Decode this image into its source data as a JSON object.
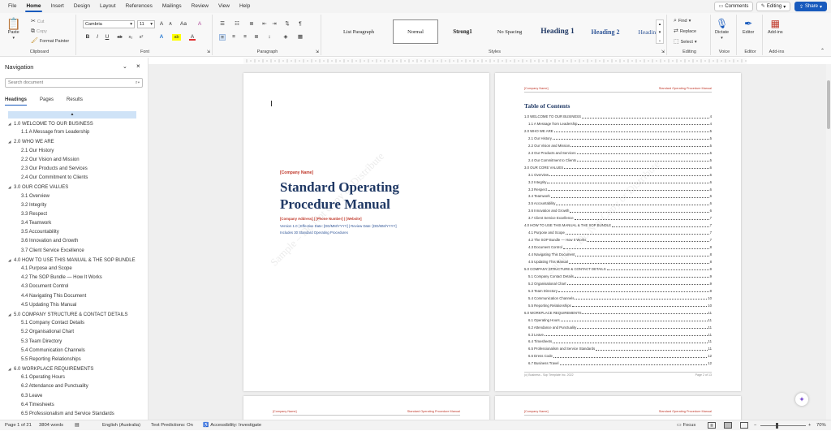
{
  "menu": {
    "tabs": [
      "File",
      "Home",
      "Insert",
      "Design",
      "Layout",
      "References",
      "Mailings",
      "Review",
      "View",
      "Help"
    ],
    "active": "Home"
  },
  "top_right": {
    "comments": "Comments",
    "editing": "Editing",
    "share": "Share"
  },
  "ribbon": {
    "clipboard": {
      "paste": "Paste",
      "cut": "Cut",
      "copy": "Copy",
      "format_painter": "Format Painter",
      "label": "Clipboard"
    },
    "font": {
      "name": "Cambria",
      "size": "11",
      "label": "Font",
      "size_up": "A",
      "size_down": "A",
      "case": "Aa",
      "clear": "A",
      "bold": "B",
      "italic": "I",
      "underline": "U",
      "strike": "ab",
      "subscript": "x₂",
      "superscript": "x²",
      "effects": "A",
      "highlight": "ab",
      "color": "A"
    },
    "paragraph": {
      "label": "Paragraph",
      "pilcrow": "¶"
    },
    "styles": {
      "label": "Styles",
      "items": [
        "List Paragraph",
        "Normal",
        "Strong1",
        "No Spacing",
        "Heading 1",
        "Heading 2",
        "Heading 3"
      ],
      "selected": "Normal"
    },
    "editing": {
      "label": "Editing",
      "find": "Find",
      "replace": "Replace",
      "select": "Select"
    },
    "voice": {
      "label": "Voice",
      "dictate": "Dictate"
    },
    "editor": {
      "label": "Editor",
      "editor": "Editor"
    },
    "addins": {
      "label": "Add-ins",
      "addins": "Add-ins"
    }
  },
  "nav": {
    "title": "Navigation",
    "search_placeholder": "Search document",
    "tabs": [
      "Headings",
      "Pages",
      "Results"
    ],
    "active_tab": "Headings",
    "collapse": "▲",
    "items": [
      {
        "level": 1,
        "text": "1.0  WELCOME TO OUR BUSINESS"
      },
      {
        "level": 2,
        "text": "1.1  A Message from Leadership"
      },
      {
        "level": 1,
        "text": "2.0  WHO WE ARE"
      },
      {
        "level": 2,
        "text": "2.1  Our History"
      },
      {
        "level": 2,
        "text": "2.2  Our Vision and Mission"
      },
      {
        "level": 2,
        "text": "2.3  Our Products and Services"
      },
      {
        "level": 2,
        "text": "2.4  Our Commitment to Clients"
      },
      {
        "level": 1,
        "text": "3.0  OUR CORE VALUES"
      },
      {
        "level": 2,
        "text": "3.1  Overview"
      },
      {
        "level": 2,
        "text": "3.2  Integrity"
      },
      {
        "level": 2,
        "text": "3.3  Respect"
      },
      {
        "level": 2,
        "text": "3.4  Teamwork"
      },
      {
        "level": 2,
        "text": "3.5  Accountability"
      },
      {
        "level": 2,
        "text": "3.6  Innovation and Growth"
      },
      {
        "level": 2,
        "text": "3.7  Client Service Excellence"
      },
      {
        "level": 1,
        "text": "4.0  HOW TO USE THIS MANUAL & THE SOP BUNDLE"
      },
      {
        "level": 2,
        "text": "4.1  Purpose and Scope"
      },
      {
        "level": 2,
        "text": "4.2  The SOP Bundle — How It Works"
      },
      {
        "level": 2,
        "text": "4.3  Document Control"
      },
      {
        "level": 2,
        "text": "4.4  Navigating This Document"
      },
      {
        "level": 2,
        "text": "4.5  Updating This Manual"
      },
      {
        "level": 1,
        "text": "5.0  COMPANY STRUCTURE & CONTACT DETAILS"
      },
      {
        "level": 2,
        "text": "5.1  Company Contact Details"
      },
      {
        "level": 2,
        "text": "5.2  Organisational Chart"
      },
      {
        "level": 2,
        "text": "5.3  Team Directory"
      },
      {
        "level": 2,
        "text": "5.4  Communication Channels"
      },
      {
        "level": 2,
        "text": "5.5  Reporting Relationships"
      },
      {
        "level": 1,
        "text": "6.0  WORKPLACE REQUIREMENTS"
      },
      {
        "level": 2,
        "text": "6.1  Operating Hours"
      },
      {
        "level": 2,
        "text": "6.2  Attendance and Punctuality"
      },
      {
        "level": 2,
        "text": "6.3  Leave"
      },
      {
        "level": 2,
        "text": "6.4  Timesheets"
      },
      {
        "level": 2,
        "text": "6.5  Professionalism and Service Standards"
      }
    ]
  },
  "cover": {
    "company": "[Company Name]",
    "title_line1": "Standard Operating",
    "title_line2": "Procedure Manual",
    "address": "[Company Address]   |   [Phone Number]   |   [Website]",
    "version": "Version 1.0   |   Effective Date: [DD/MM/YYYY]   |   Review Date: [DD/MM/YYYY]",
    "includes": "Includes 30 Standard Operating Procedures",
    "watermark": "Sample – Do Not Copy or Distribute"
  },
  "toc": {
    "header_left": "[Company Name]",
    "header_right": "Standard Operating Procedure Manual",
    "title": "Table of Contents",
    "footer_left": "(c) Business - Sop Template Inc. 2022",
    "footer_right": "Page 2 of 13",
    "watermark": "Sample – Do Not Copy or Distribute",
    "entries": [
      {
        "level": 1,
        "text": "1.0  WELCOME TO OUR BUSINESS",
        "page": "4"
      },
      {
        "level": 2,
        "text": "1.1  A Message from Leadership",
        "page": "4"
      },
      {
        "level": 1,
        "text": "2.0  WHO WE ARE",
        "page": "5"
      },
      {
        "level": 2,
        "text": "2.1  Our History",
        "page": "5"
      },
      {
        "level": 2,
        "text": "2.2  Our Vision and Mission",
        "page": "5"
      },
      {
        "level": 2,
        "text": "2.3  Our Products and Services",
        "page": "5"
      },
      {
        "level": 2,
        "text": "2.4  Our Commitment to Clients",
        "page": "5"
      },
      {
        "level": 1,
        "text": "3.0  OUR CORE VALUES",
        "page": "6"
      },
      {
        "level": 2,
        "text": "3.1  Overview",
        "page": "6"
      },
      {
        "level": 2,
        "text": "3.2  Integrity",
        "page": "6"
      },
      {
        "level": 2,
        "text": "3.3  Respect",
        "page": "6"
      },
      {
        "level": 2,
        "text": "3.4  Teamwork",
        "page": "6"
      },
      {
        "level": 2,
        "text": "3.5  Accountability",
        "page": "6"
      },
      {
        "level": 2,
        "text": "3.6  Innovation and Growth",
        "page": "6"
      },
      {
        "level": 2,
        "text": "3.7  Client Service Excellence",
        "page": "7"
      },
      {
        "level": 1,
        "text": "4.0  HOW TO USE THIS MANUAL & THE SOP BUNDLE",
        "page": "7"
      },
      {
        "level": 2,
        "text": "4.1  Purpose and Scope",
        "page": "7"
      },
      {
        "level": 2,
        "text": "4.2  The SOP Bundle — How It Works",
        "page": "7"
      },
      {
        "level": 2,
        "text": "4.3  Document Control",
        "page": "8"
      },
      {
        "level": 2,
        "text": "4.4  Navigating This Document",
        "page": "8"
      },
      {
        "level": 2,
        "text": "4.5  Updating This Manual",
        "page": "8"
      },
      {
        "level": 1,
        "text": "5.0  COMPANY STRUCTURE & CONTACT DETAILS",
        "page": "9"
      },
      {
        "level": 2,
        "text": "5.1  Company Contact Details",
        "page": "9"
      },
      {
        "level": 2,
        "text": "5.2  Organisational Chart",
        "page": "9"
      },
      {
        "level": 2,
        "text": "5.3  Team Directory",
        "page": "9"
      },
      {
        "level": 2,
        "text": "5.4  Communication Channels",
        "page": "10"
      },
      {
        "level": 2,
        "text": "5.5  Reporting Relationships",
        "page": "10"
      },
      {
        "level": 1,
        "text": "6.0  WORKPLACE REQUIREMENTS",
        "page": "11"
      },
      {
        "level": 2,
        "text": "6.1  Operating Hours",
        "page": "11"
      },
      {
        "level": 2,
        "text": "6.2  Attendance and Punctuality",
        "page": "11"
      },
      {
        "level": 2,
        "text": "6.3  Leave",
        "page": "11"
      },
      {
        "level": 2,
        "text": "6.4  Timesheets",
        "page": "11"
      },
      {
        "level": 2,
        "text": "6.5  Professionalism and Service Standards",
        "page": "11"
      },
      {
        "level": 2,
        "text": "6.6  Dress Code",
        "page": "12"
      },
      {
        "level": 2,
        "text": "6.7  Business Travel",
        "page": "12"
      }
    ]
  },
  "page3": {
    "header_left": "[Company Name]",
    "header_right": "Standard Operating Procedure Manual"
  },
  "page4": {
    "header_left": "[Company Name]",
    "header_right": "Standard Operating Procedure Manual"
  },
  "status": {
    "page": "Page 1 of 21",
    "words": "3804 words",
    "language": "English (Australia)",
    "predictions": "Text Predictions: On",
    "accessibility": "Accessibility: Investigate",
    "focus": "Focus",
    "zoom": "70%"
  },
  "colors": {
    "accent": "#185abd",
    "heading": "#1f3864",
    "red": "#c0392b"
  }
}
